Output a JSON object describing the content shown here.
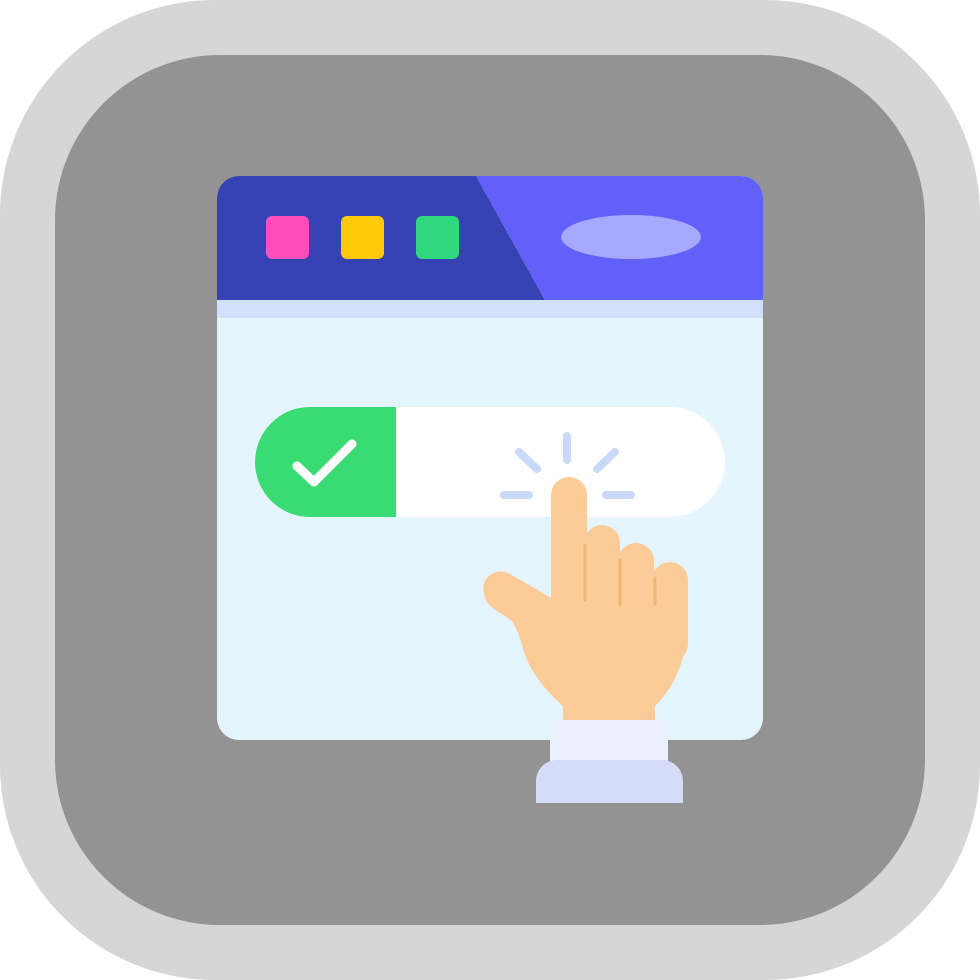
{
  "icon": {
    "subject": "browser-toggle-switch-click",
    "colors": {
      "outer_frame": "#d6d6d6",
      "inner_tile": "#939393",
      "window_body": "#e4f5fd",
      "window_divider": "#d1e0fa",
      "titlebar_dark": "#3641b3",
      "titlebar_light": "#6160f8",
      "address_pill": "#a5a8fe",
      "dot_pink": "#fc4dbb",
      "dot_yellow": "#ffc90a",
      "dot_green": "#2fd87d",
      "toggle_track": "#ffffff",
      "toggle_on": "#39dc73",
      "check_mark": "#ffffff",
      "click_rays": "#c9d9f7",
      "hand_skin": "#fbcb98",
      "hand_crease": "#f2b47d",
      "cuff_top": "#eaf0fd",
      "cuff_bottom": "#d4dcf8"
    },
    "toggle": {
      "state": "on"
    }
  }
}
